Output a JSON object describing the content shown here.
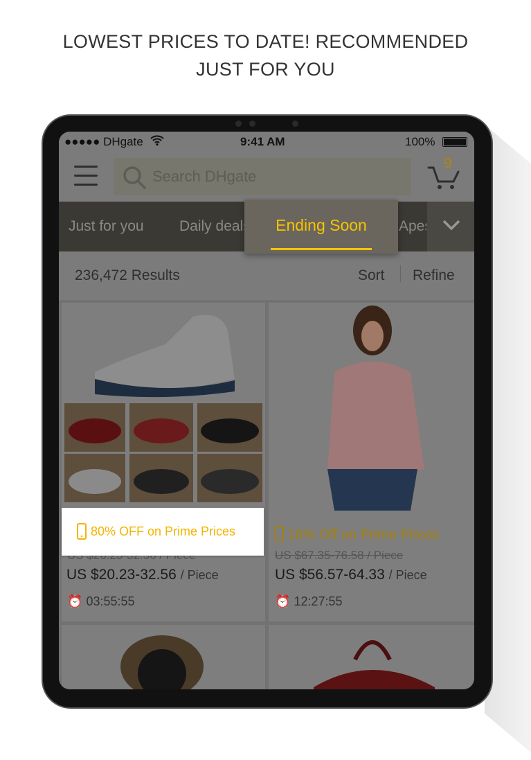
{
  "headline": [
    "LOWEST PRICES TO DATE! RECOMMENDED",
    "JUST FOR YOU"
  ],
  "status": {
    "carrier": "●●●●● DHgate",
    "time": "9:41 AM",
    "battery": "100%"
  },
  "search": {
    "placeholder": "Search DHgate"
  },
  "cart": {
    "count": "9"
  },
  "tabs": [
    "Just for you",
    "Daily deals",
    "Ending Soon",
    "Apes"
  ],
  "active_tab": "Ending Soon",
  "results": {
    "count": "236,472 Results",
    "sort": "Sort",
    "refine": "Refine"
  },
  "products": [
    {
      "promo": "80% OFF on Prime Prices",
      "old_price": "US $26.23-32.56 / Piece",
      "price": "US $20.23-32.56",
      "unit": "/ Piece",
      "timer": "03:55:55"
    },
    {
      "promo": "16% Off on Prime Prices",
      "old_price": "US $67.35-76.58 / Piece",
      "price": "US $56.57-64.33",
      "unit": "/ Piece",
      "timer": "12:27:55"
    }
  ],
  "colors": {
    "accent": "#f5c400",
    "promo": "#f4b400",
    "tab_bar": "#3b3934"
  }
}
